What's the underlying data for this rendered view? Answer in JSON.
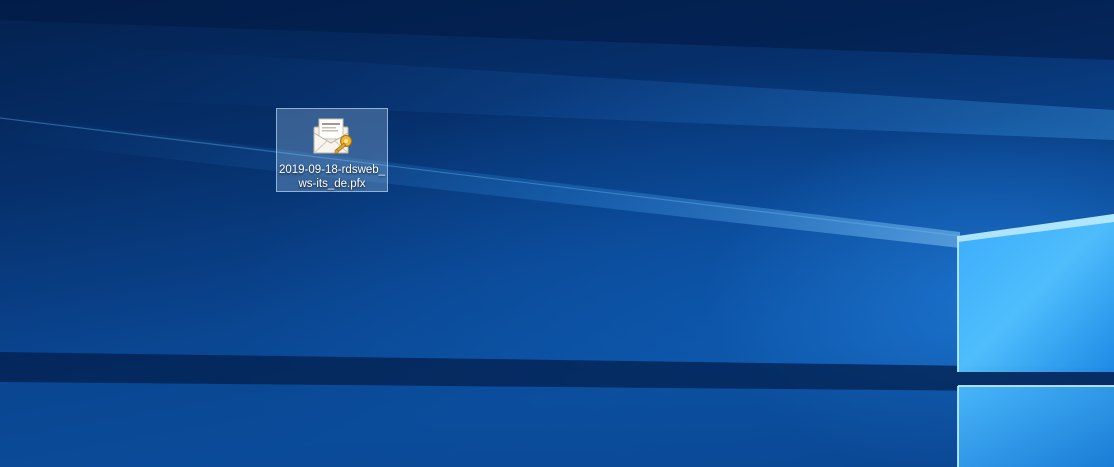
{
  "desktop": {
    "icons": [
      {
        "icon": "certificate-pfx-icon",
        "filename_line1": "2019-09-18-rdsweb_",
        "filename_line2": "ws-its_de.pfx",
        "selected": true
      }
    ],
    "wallpaper": {
      "name": "windows-10-hero",
      "accent_color": "#0a4590",
      "highlight_color": "#47b4ff"
    }
  }
}
